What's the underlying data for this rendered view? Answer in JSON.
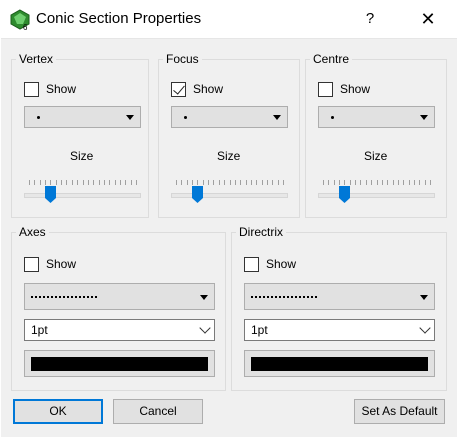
{
  "window": {
    "title": "Conic Section Properties",
    "help_label": "?",
    "close_label": "✕"
  },
  "vertex": {
    "title": "Vertex",
    "show_label": "Show",
    "show_checked": false,
    "point_style": "·",
    "size_label": "Size",
    "size_value_fraction": 0.2
  },
  "focus": {
    "title": "Focus",
    "show_label": "Show",
    "show_checked": true,
    "point_style": "·",
    "size_label": "Size",
    "size_value_fraction": 0.2
  },
  "centre": {
    "title": "Centre",
    "show_label": "Show",
    "show_checked": false,
    "point_style": "·",
    "size_label": "Size",
    "size_value_fraction": 0.2
  },
  "axes": {
    "title": "Axes",
    "show_label": "Show",
    "show_checked": false,
    "line_style": "dotted",
    "width_value": "1pt",
    "color": "#000000"
  },
  "directrix": {
    "title": "Directrix",
    "show_label": "Show",
    "show_checked": false,
    "line_style": "dotted",
    "width_value": "1pt",
    "color": "#000000"
  },
  "buttons": {
    "ok": "OK",
    "cancel": "Cancel",
    "set_default": "Set As Default"
  },
  "colors": {
    "accent": "#0078d7",
    "thumb": "#0078d7"
  },
  "icons": {
    "app": "geometry-app-icon",
    "help": "help-icon",
    "close": "close-icon"
  }
}
